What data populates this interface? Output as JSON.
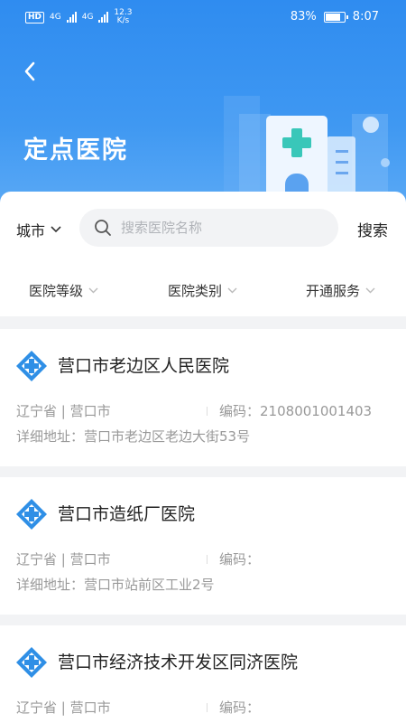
{
  "status_bar": {
    "hd_label": "HD",
    "net_a": "4G",
    "net_b": "4G",
    "speed": "12.3",
    "speed_unit": "K/s",
    "battery": "83%",
    "time": "8:07"
  },
  "header": {
    "title": "定点医院",
    "accent_color": "#2f8cf0"
  },
  "filter": {
    "city_label": "城市",
    "search_placeholder": "搜索医院名称",
    "search_button": "搜索",
    "dropdowns": [
      "医院等级",
      "医院类别",
      "开通服务"
    ]
  },
  "hospitals": [
    {
      "name": "营口市老边区人民医院",
      "region": "辽宁省 | 营口市",
      "code_label": "编码：",
      "code": "2108001001403",
      "address": "详细地址：营口市老边区老边大街53号"
    },
    {
      "name": "营口市造纸厂医院",
      "region": "辽宁省 | 营口市",
      "code_label": "编码：",
      "code": "",
      "address": "详细地址：营口市站前区工业2号"
    },
    {
      "name": "营口市经济技术开发区同济医院",
      "region": "辽宁省 | 营口市",
      "code_label": "编码：",
      "code": "",
      "address": ""
    }
  ]
}
